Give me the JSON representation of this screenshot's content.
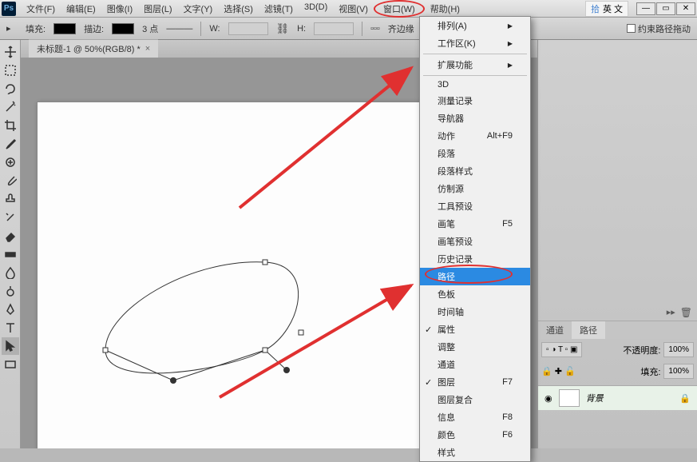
{
  "app": {
    "logo": "Ps"
  },
  "menus": {
    "file": "文件(F)",
    "edit": "编辑(E)",
    "image": "图像(I)",
    "layer": "图层(L)",
    "type": "文字(Y)",
    "select": "选择(S)",
    "filter": "滤镜(T)",
    "3d": "3D(D)",
    "view": "视图(V)",
    "window": "窗口(W)",
    "help": "帮助(H)"
  },
  "ime": {
    "flag": "拾",
    "lang": "英 文"
  },
  "options": {
    "fill_label": "填充:",
    "stroke_label": "描边:",
    "pts": "3 点",
    "w": "W:",
    "h": "H:",
    "constrain": "约束路径拖动",
    "align_edges": "齐边缘"
  },
  "doc": {
    "tab_title": "未标题-1 @ 50%(RGB/8) *"
  },
  "window_menu": [
    {
      "k": "arrange",
      "label": "排列(A)",
      "sub": true
    },
    {
      "k": "workspace",
      "label": "工作区(K)",
      "sub": true
    },
    {
      "sep": true
    },
    {
      "k": "extensions",
      "label": "扩展功能",
      "sub": true
    },
    {
      "sep": true
    },
    {
      "k": "3d",
      "label": "3D"
    },
    {
      "k": "measurement",
      "label": "测量记录"
    },
    {
      "k": "navigator",
      "label": "导航器"
    },
    {
      "k": "actions",
      "label": "动作",
      "shortcut": "Alt+F9"
    },
    {
      "k": "paragraph",
      "label": "段落"
    },
    {
      "k": "parastyles",
      "label": "段落样式"
    },
    {
      "k": "clonesource",
      "label": "仿制源"
    },
    {
      "k": "toolpresets",
      "label": "工具预设"
    },
    {
      "k": "brush",
      "label": "画笔",
      "shortcut": "F5"
    },
    {
      "k": "brushpresets",
      "label": "画笔预设"
    },
    {
      "k": "history",
      "label": "历史记录"
    },
    {
      "k": "paths",
      "label": "路径",
      "highlight": true
    },
    {
      "k": "swatches",
      "label": "色板"
    },
    {
      "k": "timeline",
      "label": "时间轴"
    },
    {
      "k": "properties",
      "label": "属性",
      "check": true
    },
    {
      "k": "adjustments",
      "label": "调整"
    },
    {
      "k": "channels",
      "label": "通道"
    },
    {
      "k": "layers",
      "label": "图层",
      "shortcut": "F7",
      "check": true
    },
    {
      "k": "layercomps",
      "label": "图层复合"
    },
    {
      "k": "info",
      "label": "信息",
      "shortcut": "F8"
    },
    {
      "k": "color",
      "label": "颜色",
      "shortcut": "F6"
    },
    {
      "k": "styles",
      "label": "样式"
    }
  ],
  "panels": {
    "tabs": {
      "channels": "通道",
      "paths": "路径"
    },
    "opacity_label": "不透明度:",
    "opacity_value": "100%",
    "fill_label": "填充:",
    "fill_value": "100%",
    "layer_name": "背景"
  }
}
